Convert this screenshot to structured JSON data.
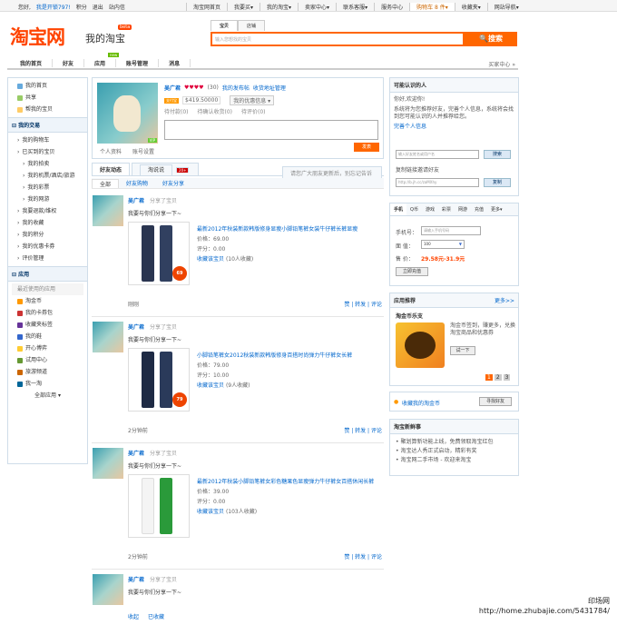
{
  "topbar": {
    "greeting": "您好,",
    "user": "我是开锁797!",
    "coins": "积分",
    "logout": "退出",
    "msgs": "站内信",
    "links": [
      "淘宝网首页",
      "我要买▾",
      "我的淘宝▾",
      "卖家中心▾",
      "联系客服▾",
      "服务中心",
      "购物车 8 件▾",
      "收藏夹▾",
      "网站导航▾"
    ]
  },
  "header": {
    "logo": "淘宝网",
    "my": "我的淘宝",
    "beta": "beta",
    "search_tabs": [
      "宝贝",
      "店铺"
    ],
    "search_placeholder": "输入您想找的宝贝",
    "search_btn": "搜索"
  },
  "nav": {
    "items": [
      "我的首页",
      "好友",
      "应用",
      "账号管理",
      "消息"
    ],
    "new": "new",
    "right": "买家中心 »"
  },
  "left": {
    "top": [
      "我的首页",
      "共享",
      "帮我的宝贝"
    ],
    "trade_head": "我的交易",
    "trade": [
      "我的购物车",
      "已买到的宝贝",
      "我的拍卖",
      "我的机票/酒店/旅游",
      "我的彩票",
      "我的网游",
      "我要退款/维权",
      "我的收藏",
      "我的积分",
      "我的优惠卡券",
      "评价管理"
    ],
    "apps_head": "应用",
    "apps_sub": "最近使用的应用",
    "apps": [
      "淘金币",
      "我的卡券包",
      "收藏夹标签",
      "我的鞋",
      "开心博弈",
      "试用中心",
      "旅游频道",
      "我一淘"
    ],
    "apps_all": "全部应用 ▾"
  },
  "profile": {
    "name": "吴广君",
    "hearts": "♥♥♥♥",
    "count": "(30)",
    "my_items": "我的发布帖",
    "edit": "收货地址管理",
    "follow": "我的优惠信息 ▾",
    "alipay": "支付宝",
    "credit": "$419.50000",
    "pending": [
      "待付款(0)",
      "待确认收货(0)",
      "待评价(0)"
    ],
    "plinks": [
      "个人资料",
      "账号设置"
    ],
    "post": "发表",
    "vip": "VIP"
  },
  "feed_tabs": {
    "items": [
      "好友动态",
      "淘说说",
      "话题"
    ],
    "num": "20+",
    "hint": "请您广大朋友更新后，别忘记告诉你的朋友哦"
  },
  "filter": [
    "全部",
    "好友购物",
    "好友分享"
  ],
  "feeds": [
    {
      "name": "吴广君",
      "action": "分享了宝贝",
      "say": "我要与你们分享一下~",
      "title": "最新2012年秋装新款韩版修身显瘦小脚铅笔裤女装牛仔裤长裤显瘦",
      "price": "价格：69.00",
      "rating": "评分：0.00",
      "fav": "收藏该宝贝",
      "favc": "(10人收藏)",
      "act": "刚刚",
      "ops": "赞 | 转发 | 评论",
      "tag": "69"
    },
    {
      "name": "吴广君",
      "action": "分享了宝贝",
      "say": "我要与你们分享一下~",
      "title": "小脚铅笔裤女2012秋装新款韩版修身百搭时尚弹力牛仔裤女长裤",
      "price": "价格：79.00",
      "rating": "评分：10.00",
      "fav": "收藏该宝贝",
      "favc": "(9人收藏)",
      "act": "2分钟前",
      "ops": "赞 | 转发 | 评论",
      "tag": "79"
    },
    {
      "name": "吴广君",
      "action": "分享了宝贝",
      "say": "我要与你们分享一下~",
      "title": "最新2012年秋装小脚铅笔裤女彩色糖果色显瘦弹力牛仔裤女百搭休闲长裤",
      "price": "价格：39.00",
      "rating": "评分：0.00",
      "fav": "收藏该宝贝",
      "favc": "(103人收藏)",
      "act": "2分钟前",
      "ops": "赞 | 转发 | 评论",
      "tag": ""
    },
    {
      "name": "吴广君",
      "action": "分享了宝贝",
      "say": "我要与你们分享一下~",
      "act": "收起",
      "ops": "已收藏"
    }
  ],
  "right": {
    "invite_head": "可能认识的人",
    "invite_text1": "你好,欢迎你!",
    "invite_text2": "系统将为您推荐好友，完善个人信息，系统将会找到您可能认识的人并推荐给您。",
    "invite_link": "完善个人信息",
    "search_ph": "输入好友姓名或用户名",
    "search_btn": "搜索",
    "url_label": "复制链接邀请好友",
    "url": "http://b.jh.cc/zaMXhy",
    "copy": "复制",
    "recharge_tabs": [
      "手机",
      "Q币",
      "游戏",
      "彩票",
      "网游",
      "充值",
      "更多▾"
    ],
    "phone_label": "手机号：",
    "phone_ph": "请输入手机号码",
    "amount_label": "面 值：",
    "amount": "100",
    "price_label": "售 价：",
    "price": "29.58元-31.9元",
    "pay_btn": "立即充值",
    "promo_head": "应用推荐",
    "promo_more": "更多>>",
    "promo_title": "淘金币乐支",
    "promo_text": "淘金币签到，赚更多，兑换淘宝商品和优惠券",
    "promo_btn": "试一下",
    "promo_pages": [
      "1",
      "2",
      "3"
    ],
    "sub_link": "收藏我的淘金币",
    "sub_btn": "寻找好友",
    "news_head": "淘宝新鲜事",
    "news": [
      "• 聚划算新功能上线，免费领取淘宝红包",
      "• 淘宝达人秀正式启动，精彩有奖",
      "• 淘宝网二手市场 - 欢迎来淘宝"
    ]
  },
  "watermark": {
    "line1": "印场网",
    "line2": "http://home.zhubajie.com/5431784/"
  }
}
